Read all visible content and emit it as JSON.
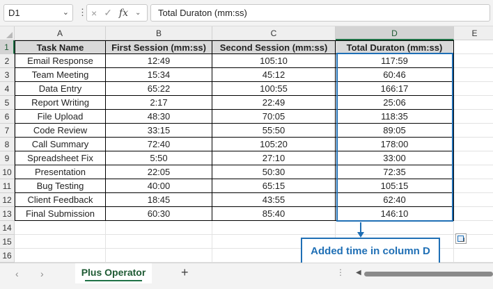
{
  "formula_bar": {
    "name_box": "D1",
    "name_box_chevron": "chevron-down-icon",
    "more_icon": "vertical-ellipsis-icon",
    "cancel_icon": "×",
    "enter_icon": "✓",
    "fx_label": "fx",
    "formula": "Total Duraton (mm:ss)"
  },
  "columns": [
    "A",
    "B",
    "C",
    "D",
    "E"
  ],
  "selected_column": "D",
  "rows": [
    "1",
    "2",
    "3",
    "4",
    "5",
    "6",
    "7",
    "8",
    "9",
    "10",
    "11",
    "12",
    "13",
    "14",
    "15",
    "16"
  ],
  "selected_row": "1",
  "table": {
    "headers": [
      "Task Name",
      "First Session (mm:ss)",
      "Second Session (mm:ss)",
      "Total Duraton (mm:ss)"
    ],
    "rows": [
      [
        "Email Response",
        "12:49",
        "105:10",
        "117:59"
      ],
      [
        "Team Meeting",
        "15:34",
        "45:12",
        "60:46"
      ],
      [
        "Data Entry",
        "65:22",
        "100:55",
        "166:17"
      ],
      [
        "Report Writing",
        "2:17",
        "22:49",
        "25:06"
      ],
      [
        "File Upload",
        "48:30",
        "70:05",
        "118:35"
      ],
      [
        "Code Review",
        "33:15",
        "55:50",
        "89:05"
      ],
      [
        "Call Summary",
        "72:40",
        "105:20",
        "178:00"
      ],
      [
        "Spreadsheet Fix",
        "5:50",
        "27:10",
        "33:00"
      ],
      [
        "Presentation",
        "22:05",
        "50:30",
        "72:35"
      ],
      [
        "Bug Testing",
        "40:00",
        "65:15",
        "105:15"
      ],
      [
        "Client Feedback",
        "18:45",
        "43:55",
        "62:40"
      ],
      [
        "Final Submission",
        "60:30",
        "85:40",
        "146:10"
      ]
    ]
  },
  "annotation": {
    "callout_text": "Added time in column D",
    "highlight_color": "#1f6fb5"
  },
  "sheet_tabs": {
    "prev_icon": "‹",
    "next_icon": "›",
    "active_tab": "Plus Operator",
    "add_icon": "+"
  },
  "colors": {
    "header_fill": "#d9d9d9",
    "accent_green": "#1e7145"
  }
}
